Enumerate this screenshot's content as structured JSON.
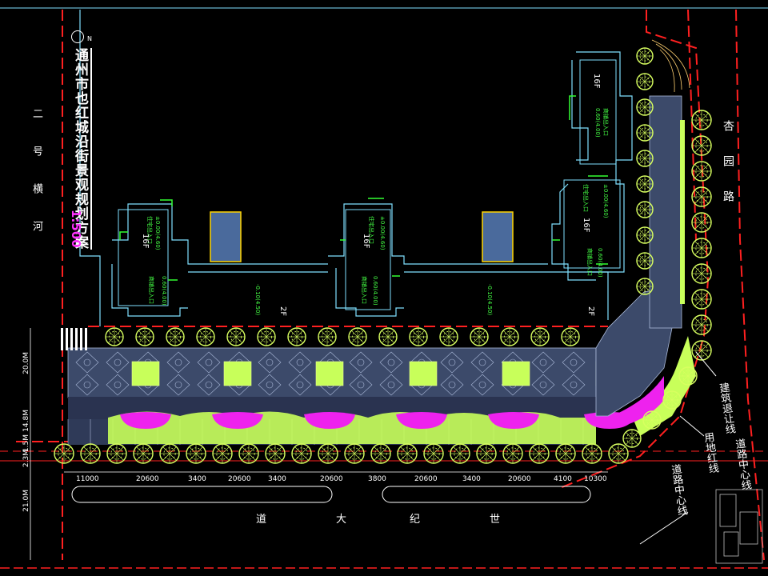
{
  "title": "通州市也红城沿街景观规划方案",
  "scale": "1:500",
  "north_mark": "N",
  "river_label": [
    "二",
    "号",
    "横",
    "河"
  ],
  "road_east": "杏园路",
  "labels": {
    "building_setback": "建筑退让线",
    "land_red_line": "用地红线",
    "road_center_line": "道路中心线",
    "road_center_line_2": "道路中心线"
  },
  "buildings": [
    {
      "floors": "16F"
    },
    {
      "floors": "16F"
    },
    {
      "floors": "16F"
    },
    {
      "floors": "16F"
    }
  ],
  "podium_floors": [
    "2F",
    "2F"
  ],
  "bottom_road": [
    "道",
    "大",
    "纪",
    "世"
  ],
  "dimensions_horizontal": [
    "11000",
    "20600",
    "3400",
    "20600",
    "3400",
    "20600",
    "3800",
    "20600",
    "3400",
    "20600",
    "4100",
    "10300"
  ],
  "dimensions_vertical": [
    "20.0M",
    "14.8M",
    "1.5M",
    "2.3M",
    "21.0M"
  ],
  "colors": {
    "background": "#000000",
    "red_line": "#ff2020",
    "cyan_line": "#7fe0ff",
    "green_tree": "#d8ff60",
    "paving": "#3c4a6a",
    "magenta": "#ee22ee",
    "lawn": "#c8ff5a",
    "blue_fill": "#4a6a9c"
  }
}
